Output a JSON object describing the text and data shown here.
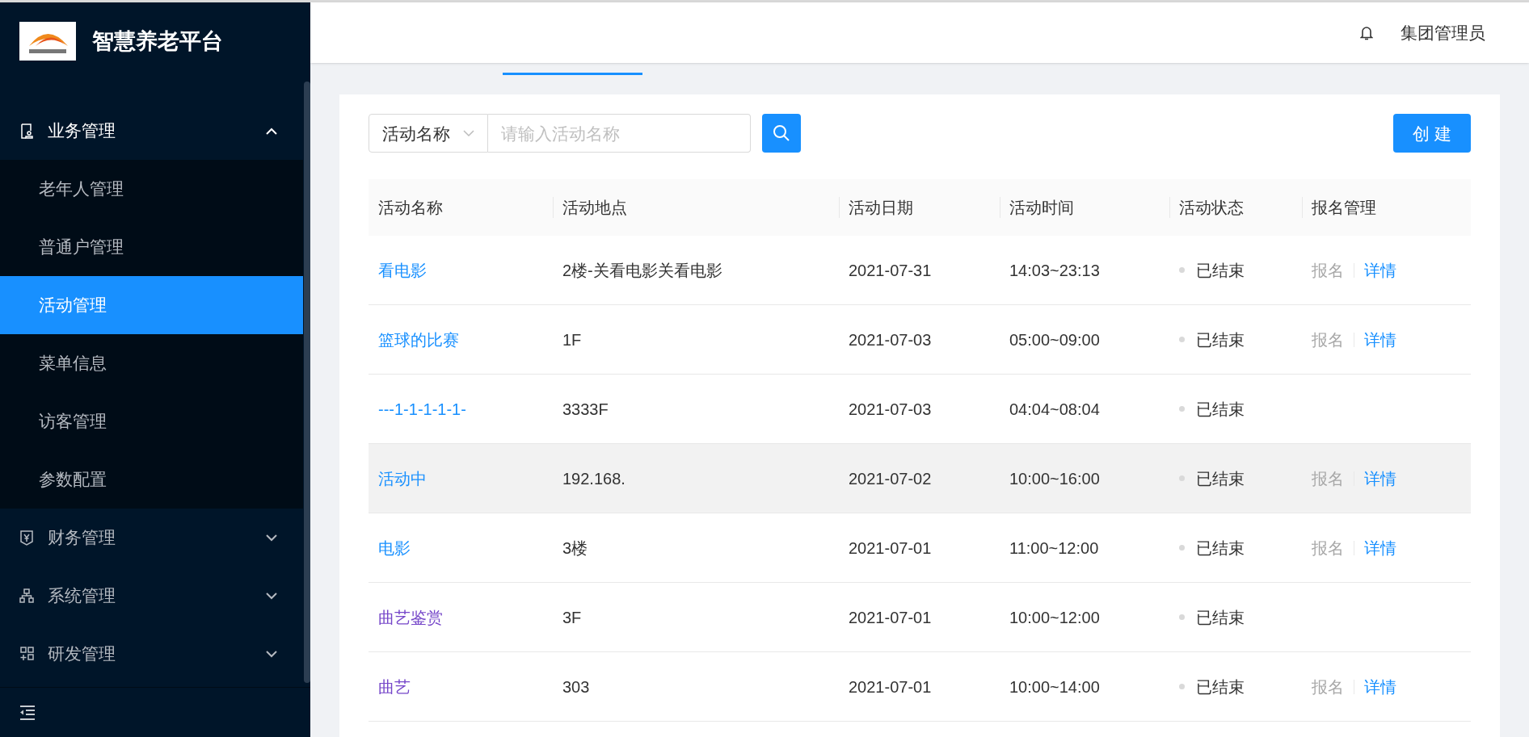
{
  "app": {
    "title": "智慧养老平台"
  },
  "header": {
    "user": "集团管理员"
  },
  "sidebar": {
    "items": [
      {
        "label": "业务管理",
        "expanded": true,
        "children": [
          {
            "label": "老年人管理",
            "selected": false
          },
          {
            "label": "普通户管理",
            "selected": false
          },
          {
            "label": "活动管理",
            "selected": true
          },
          {
            "label": "菜单信息",
            "selected": false
          },
          {
            "label": "访客管理",
            "selected": false
          },
          {
            "label": "参数配置",
            "selected": false
          }
        ]
      },
      {
        "label": "财务管理",
        "expanded": false
      },
      {
        "label": "系统管理",
        "expanded": false
      },
      {
        "label": "研发管理",
        "expanded": false
      }
    ]
  },
  "search": {
    "field": "活动名称",
    "placeholder": "请输入活动名称"
  },
  "create_button": "创 建",
  "table": {
    "columns": [
      "活动名称",
      "活动地点",
      "活动日期",
      "活动时间",
      "活动状态",
      "报名管理"
    ],
    "rows": [
      {
        "name": "看电影",
        "visited": false,
        "hovered": false,
        "place": "2楼-关看电影关看电影",
        "date": "2021-07-31",
        "time": "14:03~23:13",
        "status": "已结束",
        "signup": {
          "label": "报名",
          "disabled": true
        },
        "detail": "详情"
      },
      {
        "name": "篮球的比赛",
        "visited": false,
        "hovered": false,
        "place": "1F",
        "date": "2021-07-03",
        "time": "05:00~09:00",
        "status": "已结束",
        "signup": {
          "label": "报名",
          "disabled": true
        },
        "detail": "详情"
      },
      {
        "name": "---1-1-1-1-1-",
        "visited": false,
        "hovered": false,
        "place": "3333F",
        "date": "2021-07-03",
        "time": "04:04~08:04",
        "status": "已结束"
      },
      {
        "name": "活动中",
        "visited": false,
        "hovered": true,
        "place": "192.168.",
        "date": "2021-07-02",
        "time": "10:00~16:00",
        "status": "已结束",
        "signup": {
          "label": "报名",
          "disabled": true
        },
        "detail": "详情"
      },
      {
        "name": "电影",
        "visited": false,
        "hovered": false,
        "place": "3楼",
        "date": "2021-07-01",
        "time": "11:00~12:00",
        "status": "已结束",
        "signup": {
          "label": "报名",
          "disabled": true
        },
        "detail": "详情"
      },
      {
        "name": "曲艺鉴赏",
        "visited": true,
        "hovered": false,
        "place": "3F",
        "date": "2021-07-01",
        "time": "10:00~12:00",
        "status": "已结束"
      },
      {
        "name": "曲艺",
        "visited": true,
        "hovered": false,
        "place": "303",
        "date": "2021-07-01",
        "time": "10:00~14:00",
        "status": "已结束",
        "signup": {
          "label": "报名",
          "disabled": true
        },
        "detail": "详情"
      }
    ]
  }
}
